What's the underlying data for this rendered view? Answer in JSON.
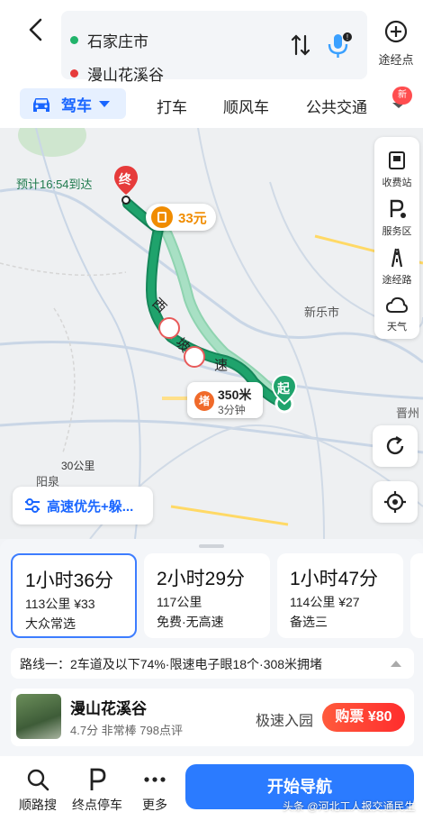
{
  "header": {
    "start": "石家庄市",
    "end": "漫山花溪谷",
    "waypoint_label": "途经点",
    "start_color": "#21b36b",
    "end_color": "#e63b3b"
  },
  "tabs": {
    "active": "驾车",
    "items": [
      "打车",
      "顺风车",
      "公共交通"
    ],
    "badge": "新"
  },
  "map": {
    "eta": "预计16:54到达",
    "end_marker": "终",
    "start_marker": "起",
    "toll": "33元",
    "road_labels": [
      "西",
      "坡",
      "速"
    ],
    "cities": [
      "新乐市",
      "阳泉",
      "晋州"
    ],
    "jam": {
      "tag": "堵",
      "distance": "350米",
      "time": "3分钟"
    },
    "side_items": [
      "收费站",
      "服务区",
      "途经路",
      "天气"
    ],
    "scale": "30公里",
    "preference": "高速优先+躲..."
  },
  "routes": [
    {
      "duration": "1小时36分",
      "meta": "113公里 ¥33",
      "tag": "大众常选",
      "selected": true
    },
    {
      "duration": "2小时29分",
      "meta": "117公里",
      "tag": "免费·无高速",
      "selected": false
    },
    {
      "duration": "1小时47分",
      "meta": "114公里 ¥27",
      "tag": "备选三",
      "selected": false
    }
  ],
  "route_info": "路线一：2车道及以下74%·限速电子眼18个·308米拥堵",
  "poi": {
    "name": "漫山花溪谷",
    "rating": "4.7分  非常棒  798点评",
    "fast_entry": "极速入园",
    "buy": "购票 ¥80"
  },
  "bottom": {
    "search_along": "顺路搜",
    "parking": "终点停车",
    "more": "更多",
    "start_nav": "开始导航"
  },
  "watermark": "头条 @河北工人报交通民生"
}
